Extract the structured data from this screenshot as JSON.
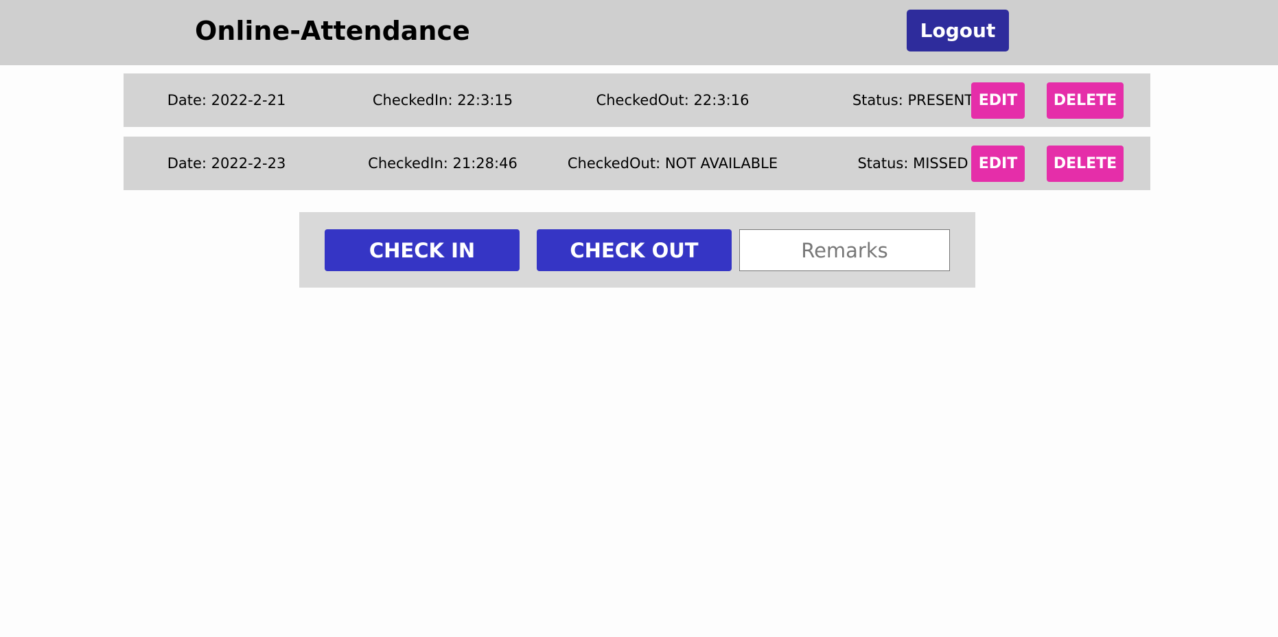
{
  "header": {
    "title": "Online-Attendance",
    "logout_label": "Logout"
  },
  "records": [
    {
      "date": "Date: 2022-2-21",
      "checked_in": "CheckedIn: 22:3:15",
      "checked_out": "CheckedOut: 22:3:16",
      "status": "Status: PRESENT",
      "edit_label": "EDIT",
      "delete_label": "DELETE"
    },
    {
      "date": "Date: 2022-2-23",
      "checked_in": "CheckedIn: 21:28:46",
      "checked_out": "CheckedOut: NOT AVAILABLE",
      "status": "Status: MISSED",
      "edit_label": "EDIT",
      "delete_label": "DELETE"
    }
  ],
  "actions": {
    "check_in_label": "CHECK IN",
    "check_out_label": "CHECK OUT",
    "remarks_placeholder": "Remarks",
    "remarks_value": ""
  },
  "colors": {
    "header_bg": "#cfcfcf",
    "logout_bg": "#2e2c9c",
    "row_bg": "#d3d3d3",
    "row_button_bg": "#e52ea9",
    "action_button_bg": "#3535c5",
    "panel_bg": "#d9d9d9"
  }
}
